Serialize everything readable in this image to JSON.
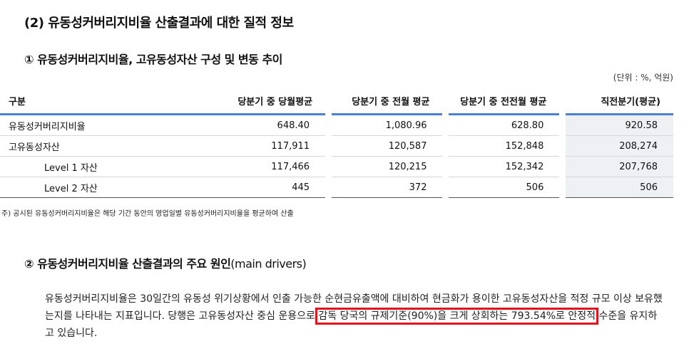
{
  "heading": "(2) 유동성커버리지비율 산출결과에 대한 질적 정보",
  "section1": {
    "title": "① 유동성커버리지비율, 고유동성자산 구성 및 변동 추이",
    "unit": "(단위 : %, 억원)",
    "headers": [
      "구분",
      "당분기 중 당월평균",
      "당분기 중 전월 평균",
      "당분기 중 전전월 평균",
      "직전분기(평균)"
    ],
    "rows": [
      {
        "label": "유동성커버리지비율",
        "values": [
          "648.40",
          "1,080.96",
          "628.80",
          "920.58"
        ]
      },
      {
        "label": "고유동성자산",
        "values": [
          "117,911",
          "120,587",
          "152,848",
          "208,274"
        ]
      },
      {
        "label": "Level 1 자산",
        "values": [
          "117,466",
          "120,215",
          "152,342",
          "207,768"
        ]
      },
      {
        "label": "Level 2 자산",
        "values": [
          "445",
          "372",
          "506",
          "506"
        ]
      }
    ],
    "note": "주) 공시된 유동성커버리지비율은 해당 기간 동안의 영업일별 유동성커버리지비율을 평균하여 산출"
  },
  "section2": {
    "title_bold": "② 유동성커버리지비율 산출결과의 주요 원인",
    "title_normal": "(main drivers)",
    "para_before": "유동성커버리지비율은 30일간의 유동성 위기상황에서 인출 가능한 순현금유출액에 대비하여 현금화가 용이한 고유동성자산을 적정 규모 이상 보유했는지를 나타내는 지표입니다. 당행은 고유동성자산 중심 운용으로 ",
    "para_highlight": "감독 당국의 규제기준(90%)을 크게 상회하는 793.54%로 안정적",
    "para_after": " 수준을 유지하고 있습니다.",
    "highlight_color": "#e0141e"
  }
}
